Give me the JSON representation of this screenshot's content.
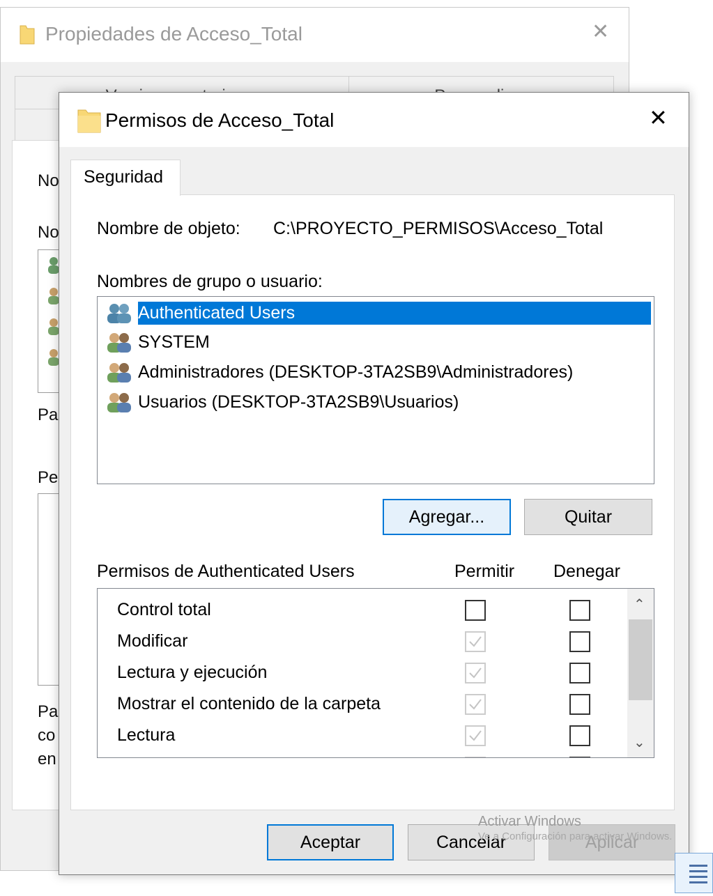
{
  "background_window": {
    "title": "Propiedades de Acceso_Total",
    "tabs": [
      "Versiones anteriores",
      "Personalizar"
    ],
    "fragments": [
      "No",
      "No",
      "Pa",
      "Pe",
      "Pa",
      "co",
      "en"
    ]
  },
  "dialog": {
    "title": "Permisos de Acceso_Total",
    "close_glyph": "✕",
    "tab": "Seguridad",
    "object_name_label": "Nombre de objeto:",
    "object_name_value": "C:\\PROYECTO_PERMISOS\\Acceso_Total",
    "group_label": "Nombres de grupo o usuario:",
    "users": [
      {
        "name": "Authenticated Users",
        "selected": true
      },
      {
        "name": "SYSTEM",
        "selected": false
      },
      {
        "name": "Administradores (DESKTOP-3TA2SB9\\Administradores)",
        "selected": false
      },
      {
        "name": "Usuarios (DESKTOP-3TA2SB9\\Usuarios)",
        "selected": false
      }
    ],
    "add_button": "Agregar...",
    "remove_button": "Quitar",
    "permissions_label": "Permisos de Authenticated Users",
    "allow_header": "Permitir",
    "deny_header": "Denegar",
    "permissions": [
      {
        "name": "Control total",
        "allow": false,
        "allow_inherited": false,
        "deny": false
      },
      {
        "name": "Modificar",
        "allow": true,
        "allow_inherited": true,
        "deny": false
      },
      {
        "name": "Lectura y ejecución",
        "allow": true,
        "allow_inherited": true,
        "deny": false
      },
      {
        "name": "Mostrar el contenido de la carpeta",
        "allow": true,
        "allow_inherited": true,
        "deny": false
      },
      {
        "name": "Lectura",
        "allow": true,
        "allow_inherited": true,
        "deny": false
      }
    ],
    "ok_button": "Aceptar",
    "cancel_button": "Cancelar",
    "apply_button": "Aplicar"
  },
  "watermark": {
    "line1": "Activar Windows",
    "line2": "Ve a Configuración para activar Windows."
  },
  "colors": {
    "selection": "#0078d7",
    "folder": "#f8d775",
    "dialog_bg": "#f0f0f0"
  }
}
